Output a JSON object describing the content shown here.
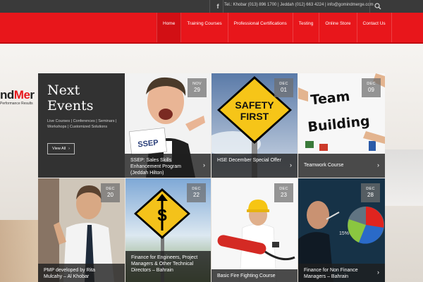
{
  "topbar": {
    "contact_text": "Tel.: Khobar (013) 896 1700 | Jeddah (012) 663 4224 | info@gomindmerge.com"
  },
  "nav": {
    "items": [
      "Home",
      "Training Courses",
      "Professional Certifications",
      "Testing",
      "Online Store",
      "Contact Us"
    ],
    "active": "Home"
  },
  "logo": {
    "text_dark": "nd",
    "text_red": "Me",
    "text_dark2": "r",
    "tagline": "Performance Results"
  },
  "events": {
    "title": "Next Events",
    "description": "Live Courses | Conferences | Seminars | Workshops | Customized Solutions",
    "button_label": "View All"
  },
  "tiles": [
    {
      "month": "NOV",
      "day": "29",
      "caption": "SSEP: Sales Skills Enhancement Program (Jeddah Hilton)"
    },
    {
      "month": "DEC",
      "day": "01",
      "caption": "HSE December Special Offer"
    },
    {
      "month": "DEC",
      "day": "09",
      "caption": "Teamwork Course"
    },
    {
      "month": "DEC",
      "day": "20",
      "caption": "PMP developed by Rita Mulcahy – Al Khobar"
    },
    {
      "month": "DEC",
      "day": "22",
      "caption": "Finance for Engineers, Project Managers & Other Technical Directors – Bahrain"
    },
    {
      "month": "DEC",
      "day": "23",
      "caption": "Basic Fire Fighting Course"
    },
    {
      "month": "DEC",
      "day": "28",
      "caption": "Finance for Non Finance Managers – Bahrain"
    }
  ],
  "art_text": {
    "safety": [
      "SAFETY",
      "FIRST"
    ],
    "team": [
      "Team",
      "Building"
    ],
    "ssep": [
      "SSEP"
    ]
  },
  "colors": {
    "brand_red": "#e8161b",
    "topbar": "#3a3a3a",
    "panel": "#323232"
  },
  "icons": {
    "facebook": "facebook-icon",
    "search": "search-icon",
    "chevron": "chevron-right-icon",
    "arrow": "arrow-right-icon"
  }
}
